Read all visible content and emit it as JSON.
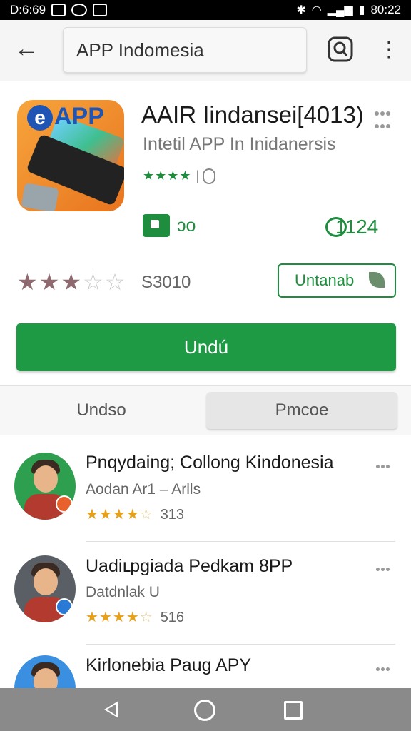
{
  "status_bar": {
    "time_left": "D:6:69",
    "time_right": "80:22"
  },
  "app_bar": {
    "search_value": "APP Indomesia",
    "back_icon": "arrow-left-icon",
    "search_icon": "search-icon",
    "more_icon": "more-vertical-icon"
  },
  "app": {
    "title": "AAIR Iindansei[4013)",
    "subtitle": "Intetil APP In Inidanersis",
    "icon_label": "APP",
    "small_stars": "★★★★",
    "downloads": "ɔo",
    "reviews": "1124",
    "rating_text": "S3010",
    "rating_value": 3,
    "rating_max": 5,
    "secondary_button": "Untanab",
    "install_button": "Undú"
  },
  "tabs": [
    {
      "label": "Undso",
      "active": false
    },
    {
      "label": "Pmcoe",
      "active": true
    }
  ],
  "list": [
    {
      "title": "Pnqydaing; Collong Kindonesia",
      "subtitle": "Aodan Ar1 – Arlls",
      "stars": 3.5,
      "rating_count": "313",
      "badge_color": "#e8612c",
      "bg_color": "#2e9e4f"
    },
    {
      "title": "Uadiւpgiada Pedkam 8PP",
      "subtitle": "Datdnlak U",
      "stars": 4,
      "rating_count": "516",
      "badge_color": "#2a7ad5",
      "bg_color": "#5a5f66"
    },
    {
      "title": "Kirlonebia Paug APY",
      "subtitle": "",
      "stars": 0,
      "rating_count": "",
      "badge_color": "#2a7ad5",
      "bg_color": "#3a8fe0"
    }
  ],
  "colors": {
    "accent_green": "#1e9a45",
    "star_gold": "#e6a019"
  }
}
